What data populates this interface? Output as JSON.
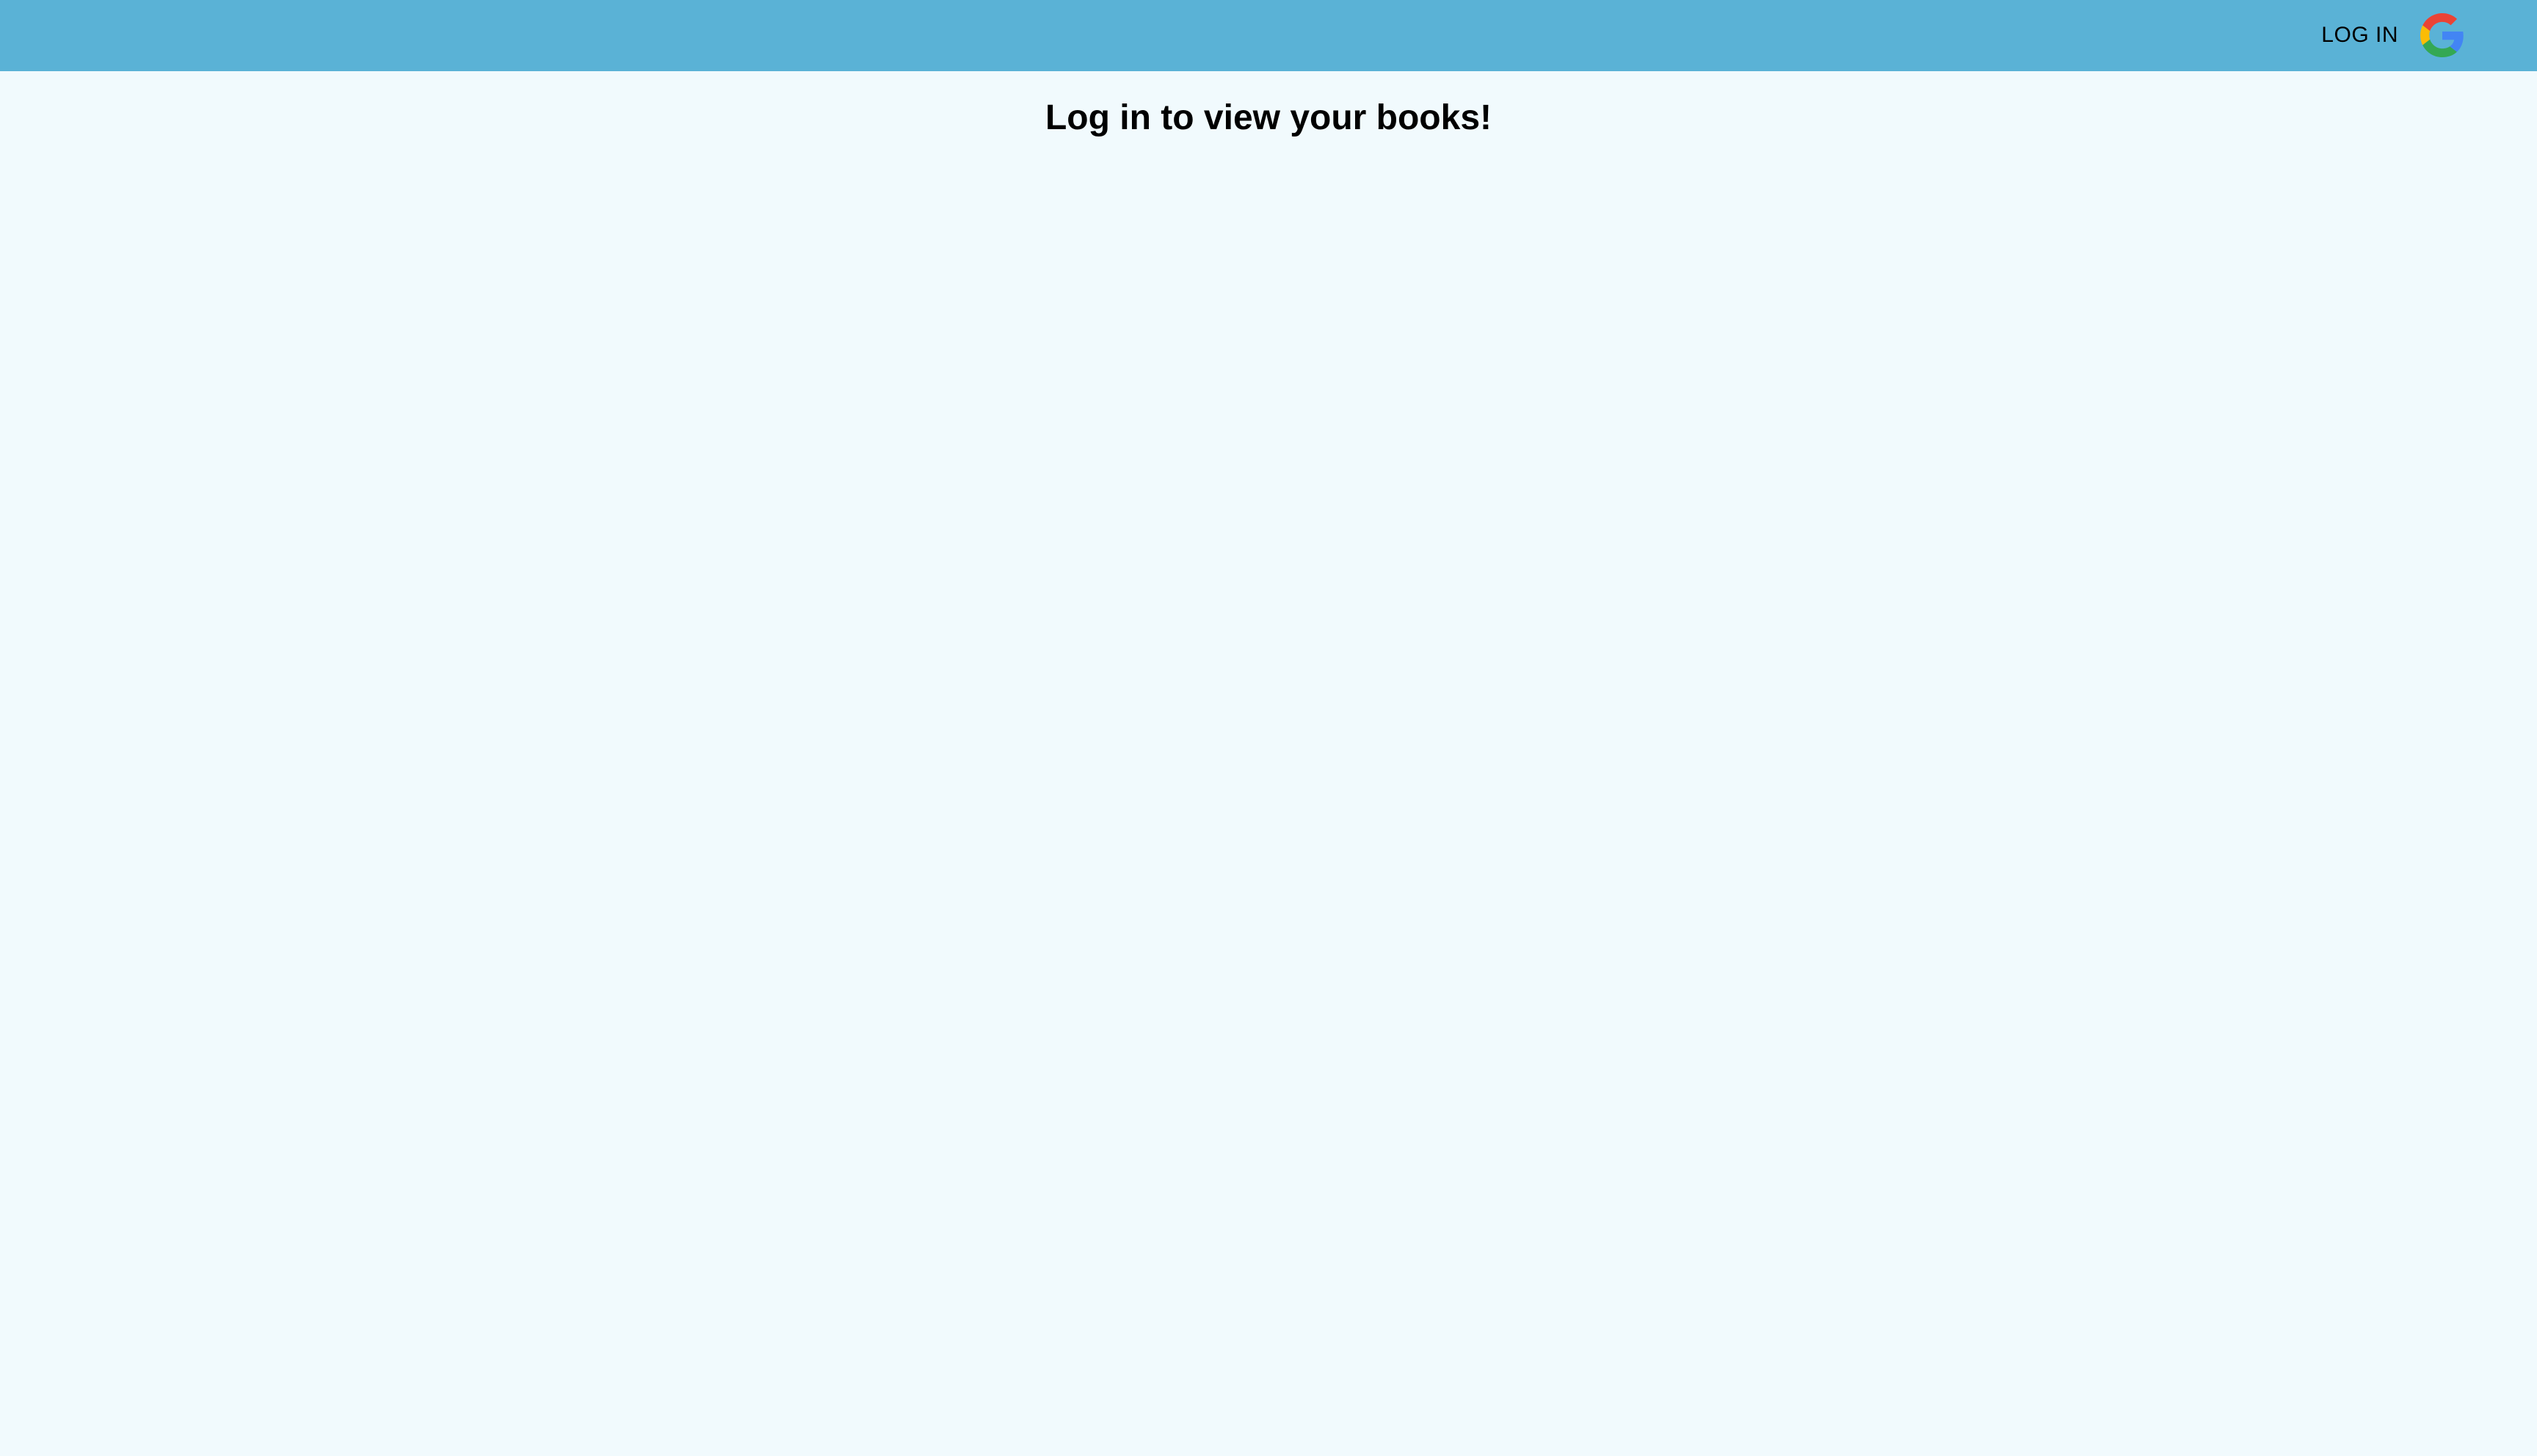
{
  "header": {
    "login_label": "LOG IN",
    "login_icon": "google-icon",
    "background_color": "#5ab2d6"
  },
  "main": {
    "title": "Log in to view your books!",
    "background_color": "#f1fafd"
  },
  "colors": {
    "google_red": "#ea4335",
    "google_yellow": "#fbbc05",
    "google_green": "#34a853",
    "google_blue": "#4285f4"
  }
}
